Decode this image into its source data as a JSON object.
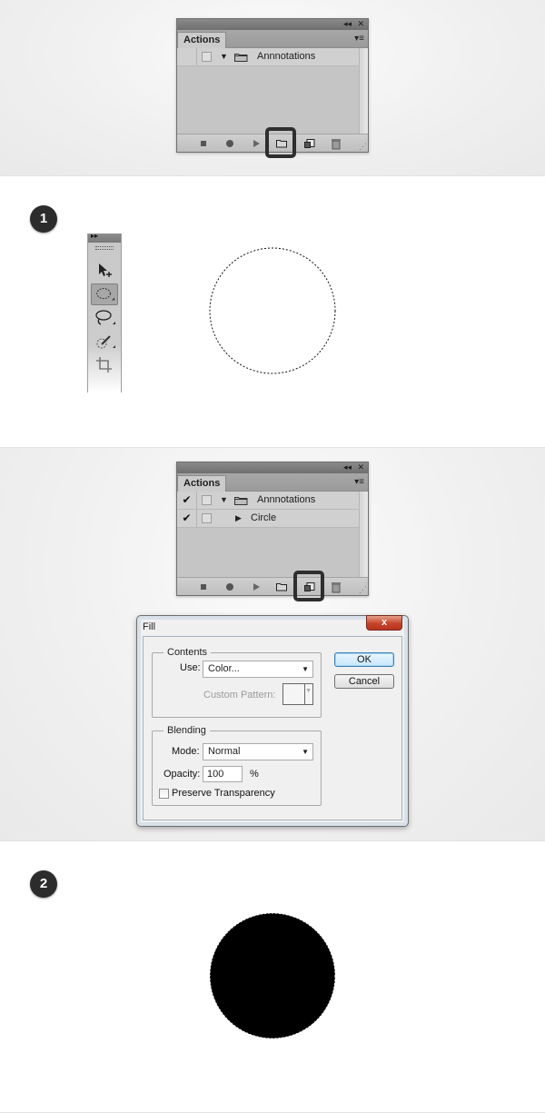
{
  "panel_1": {
    "tab_label": "Actions",
    "controls": {
      "collapse": "◂◂",
      "close": "✕",
      "menu": "▾≡"
    },
    "rows": [
      {
        "checked": "",
        "expanded": "▼",
        "label": "Annnotations",
        "type": "folder"
      }
    ],
    "footer_buttons": [
      "stop-icon",
      "record-icon",
      "play-icon",
      "new-set-icon",
      "new-action-icon",
      "trash-icon"
    ],
    "highlighted_button": "new-set-icon"
  },
  "step1": {
    "badge": "1",
    "tools": [
      "move-tool-icon",
      "ellipse-marquee-icon",
      "lasso-icon",
      "quick-select-icon",
      "crop-icon"
    ],
    "active_tool": "ellipse-marquee-icon",
    "selection": "circle"
  },
  "panel_2": {
    "tab_label": "Actions",
    "controls": {
      "collapse": "◂◂",
      "close": "✕",
      "menu": "▾≡"
    },
    "rows": [
      {
        "checked": "✔",
        "expanded": "▼",
        "label": "Annnotations",
        "type": "folder"
      },
      {
        "checked": "✔",
        "expanded": "▶",
        "label": "Circle",
        "type": "action"
      }
    ],
    "footer_buttons": [
      "stop-icon",
      "record-icon",
      "play-icon",
      "new-set-icon",
      "new-action-icon",
      "trash-icon"
    ],
    "highlighted_button": "new-action-icon"
  },
  "fill_dialog": {
    "title": "Fill",
    "close": "x",
    "contents_legend": "Contents",
    "use_label": "Use:",
    "use_value": "Color...",
    "custom_pattern_label": "Custom Pattern:",
    "blending_legend": "Blending",
    "mode_label": "Mode:",
    "mode_value": "Normal",
    "opacity_label": "Opacity:",
    "opacity_value": "100",
    "opacity_unit": "%",
    "preserve_label": "Preserve Transparency",
    "ok_label": "OK",
    "cancel_label": "Cancel"
  },
  "step2": {
    "badge": "2",
    "fill_color": "#000000"
  },
  "colors": {
    "panel_grey": "#c9c9c9",
    "badge": "#2c2c2c",
    "close_red": "#c7422a"
  }
}
